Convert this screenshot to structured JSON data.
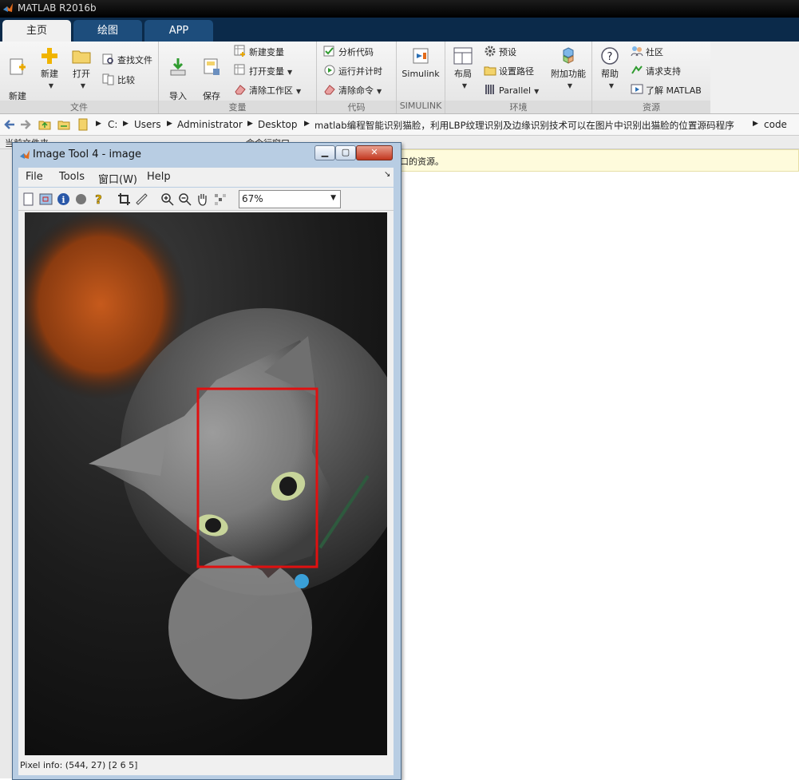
{
  "app": {
    "title": "MATLAB R2016b"
  },
  "tabs": [
    {
      "label": "主页",
      "active": true
    },
    {
      "label": "绘图",
      "active": false
    },
    {
      "label": "APP",
      "active": false
    }
  ],
  "ribbon": {
    "file": {
      "group_label": "文件",
      "new_script": "新建\n脚本",
      "new": "新建",
      "open": "打开",
      "find_files": "查找文件",
      "compare": "比较"
    },
    "variable": {
      "group_label": "变量",
      "import": "导入\n数据",
      "save_workspace": "保存\n工作区",
      "new_variable": "新建变量",
      "open_variable": "打开变量",
      "clear_workspace": "清除工作区"
    },
    "code": {
      "group_label": "代码",
      "analyze": "分析代码",
      "run_time": "运行并计时",
      "clear_commands": "清除命令"
    },
    "simulink": {
      "group_label": "SIMULINK",
      "label": "Simulink"
    },
    "environment": {
      "group_label": "环境",
      "layout": "布局",
      "preferences": "预设",
      "set_path": "设置路径",
      "parallel": "Parallel",
      "addons": "附加功能"
    },
    "resources": {
      "group_label": "资源",
      "help": "帮助",
      "community": "社区",
      "support": "请求支持",
      "learn": "了解 MATLAB"
    }
  },
  "address": {
    "crumbs": [
      "C:",
      "Users",
      "Administrator",
      "Desktop",
      "matlab编程智能识别猫脸，利用LBP纹理识别及边缘识别技术可以在图片中识别出猫脸的位置源码程序",
      "code"
    ]
  },
  "panes": {
    "current_folder": "当前文件夹",
    "command_window": "命令行窗口",
    "notice_tail": "口的资源。"
  },
  "image_tool": {
    "title": "Image Tool 4 - image",
    "menu": {
      "file": "File",
      "tools": "Tools",
      "window": "窗口(W)",
      "help": "Help"
    },
    "zoom": "67%",
    "pixel_info": "Pixel info: (544, 27)  [2 6 5]"
  },
  "colors": {
    "tab_bg": "#0b2a4a",
    "tab_inactive": "#1d4d7c",
    "detection_box": "#e01010",
    "notice_bg": "#fefbdc"
  }
}
